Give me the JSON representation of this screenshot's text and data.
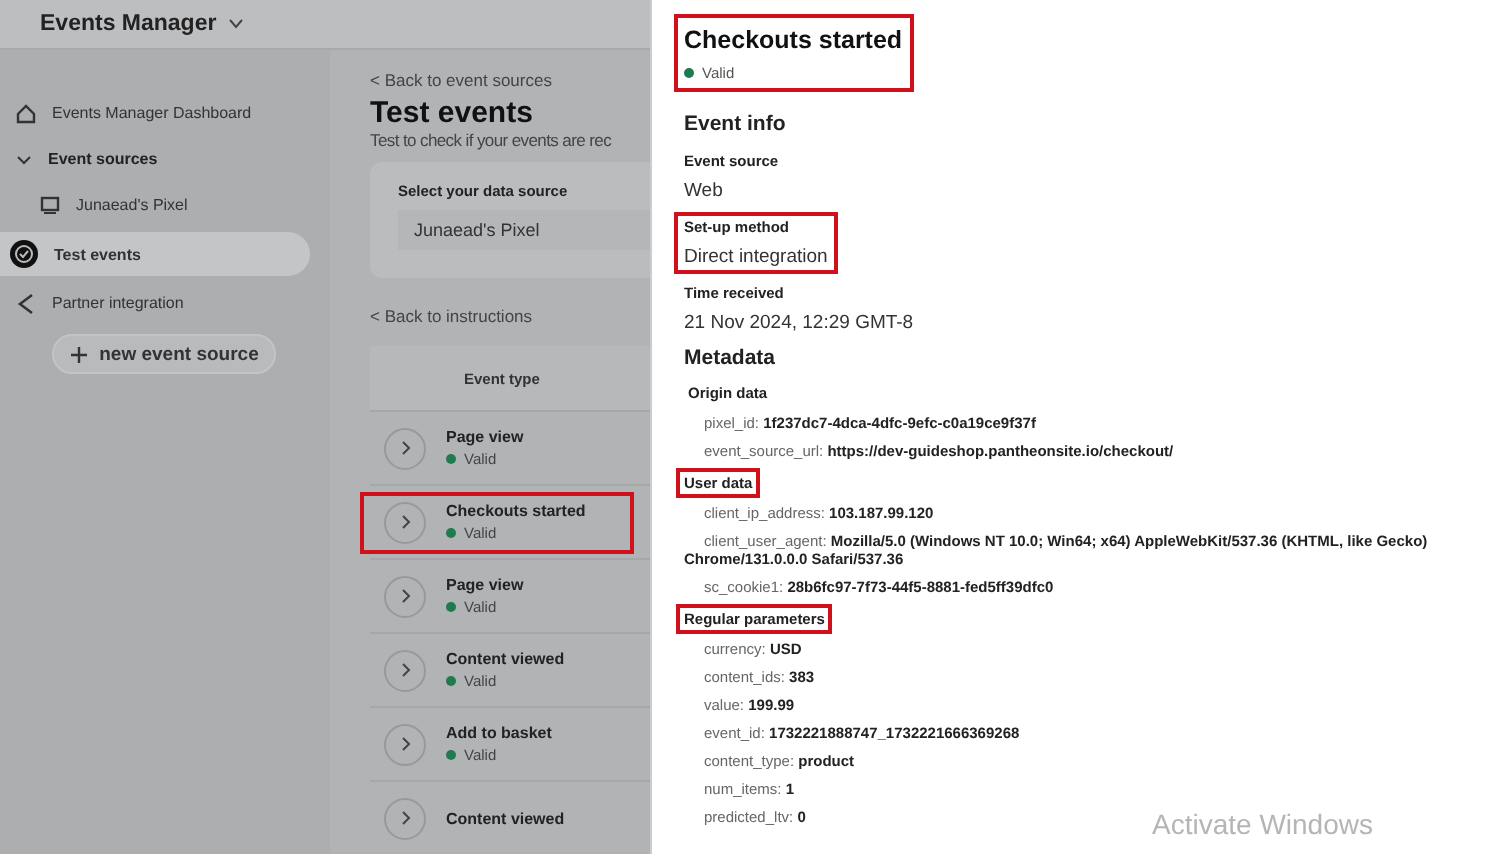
{
  "app_header": {
    "title": "Events Manager"
  },
  "sidebar": {
    "items": [
      {
        "kind": "dashboard",
        "label": "Events Manager Dashboard",
        "selected": false
      },
      {
        "kind": "group",
        "label": "Event sources",
        "expanded": true,
        "selected": false,
        "children": [
          {
            "kind": "source",
            "label": "Junaead's Pixel",
            "selected": false
          }
        ]
      },
      {
        "kind": "test",
        "label": "Test events",
        "selected": true
      },
      {
        "kind": "partner",
        "label": "Partner integration",
        "selected": false
      }
    ],
    "new_button": "new event source"
  },
  "main": {
    "back_link": "< Back to event sources",
    "title": "Test events",
    "subtitle": "Test to check if your events are rec",
    "source_card": {
      "label": "Select your data source",
      "value": "Junaead's Pixel"
    },
    "instructions_link": "< Back to instructions",
    "table": {
      "columns": [
        "Event type"
      ],
      "rows": [
        {
          "name": "Page view",
          "status": "Valid",
          "highlighted": false
        },
        {
          "name": "Checkouts started",
          "status": "Valid",
          "highlighted": true
        },
        {
          "name": "Page view",
          "status": "Valid",
          "highlighted": false
        },
        {
          "name": "Content viewed",
          "status": "Valid",
          "highlighted": false
        },
        {
          "name": "Add to basket",
          "status": "Valid",
          "highlighted": false
        },
        {
          "name": "Content viewed",
          "highlighted": false
        }
      ]
    }
  },
  "detail_panel": {
    "title": "Checkouts started",
    "status": "Valid",
    "header_highlighted": true,
    "event_info": {
      "heading": "Event info",
      "fields": [
        {
          "label": "Event source",
          "value": "Web",
          "highlighted": false
        },
        {
          "label": "Set-up method",
          "value": "Direct integration",
          "highlighted": true
        },
        {
          "label": "Time received",
          "value": "21 Nov 2024, 12:29 GMT-8",
          "highlighted": false
        }
      ]
    },
    "metadata": {
      "heading": "Metadata",
      "groups": [
        {
          "label": "Origin data",
          "highlighted": false,
          "params": [
            {
              "key": "pixel_id:",
              "value": "1f237dc7-4dca-4dfc-9efc-c0a19ce9f37f"
            },
            {
              "key": "event_source_url:",
              "value": "https://dev-guideshop.pantheonsite.io/checkout/"
            }
          ]
        },
        {
          "label": "User data",
          "highlighted": true,
          "params": [
            {
              "key": "client_ip_address:",
              "value": "103.187.99.120"
            },
            {
              "key": "client_user_agent:",
              "value": "Mozilla/5.0 (Windows NT 10.0; Win64; x64) AppleWebKit/537.36 (KHTML, like Gecko) Chrome/131.0.0.0 Safari/537.36"
            },
            {
              "key": "sc_cookie1:",
              "value": "28b6fc97-7f73-44f5-8881-fed5ff39dfc0"
            }
          ]
        },
        {
          "label": "Regular parameters",
          "highlighted": true,
          "params": [
            {
              "key": "currency:",
              "value": "USD"
            },
            {
              "key": "content_ids:",
              "value": "383"
            },
            {
              "key": "value:",
              "value": "199.99"
            },
            {
              "key": "event_id:",
              "value": "1732221888747_1732221666369268"
            },
            {
              "key": "content_type:",
              "value": "product"
            },
            {
              "key": "num_items:",
              "value": "1"
            },
            {
              "key": "predicted_ltv:",
              "value": "0"
            }
          ]
        }
      ]
    }
  },
  "system_notice": "Activate Windows"
}
